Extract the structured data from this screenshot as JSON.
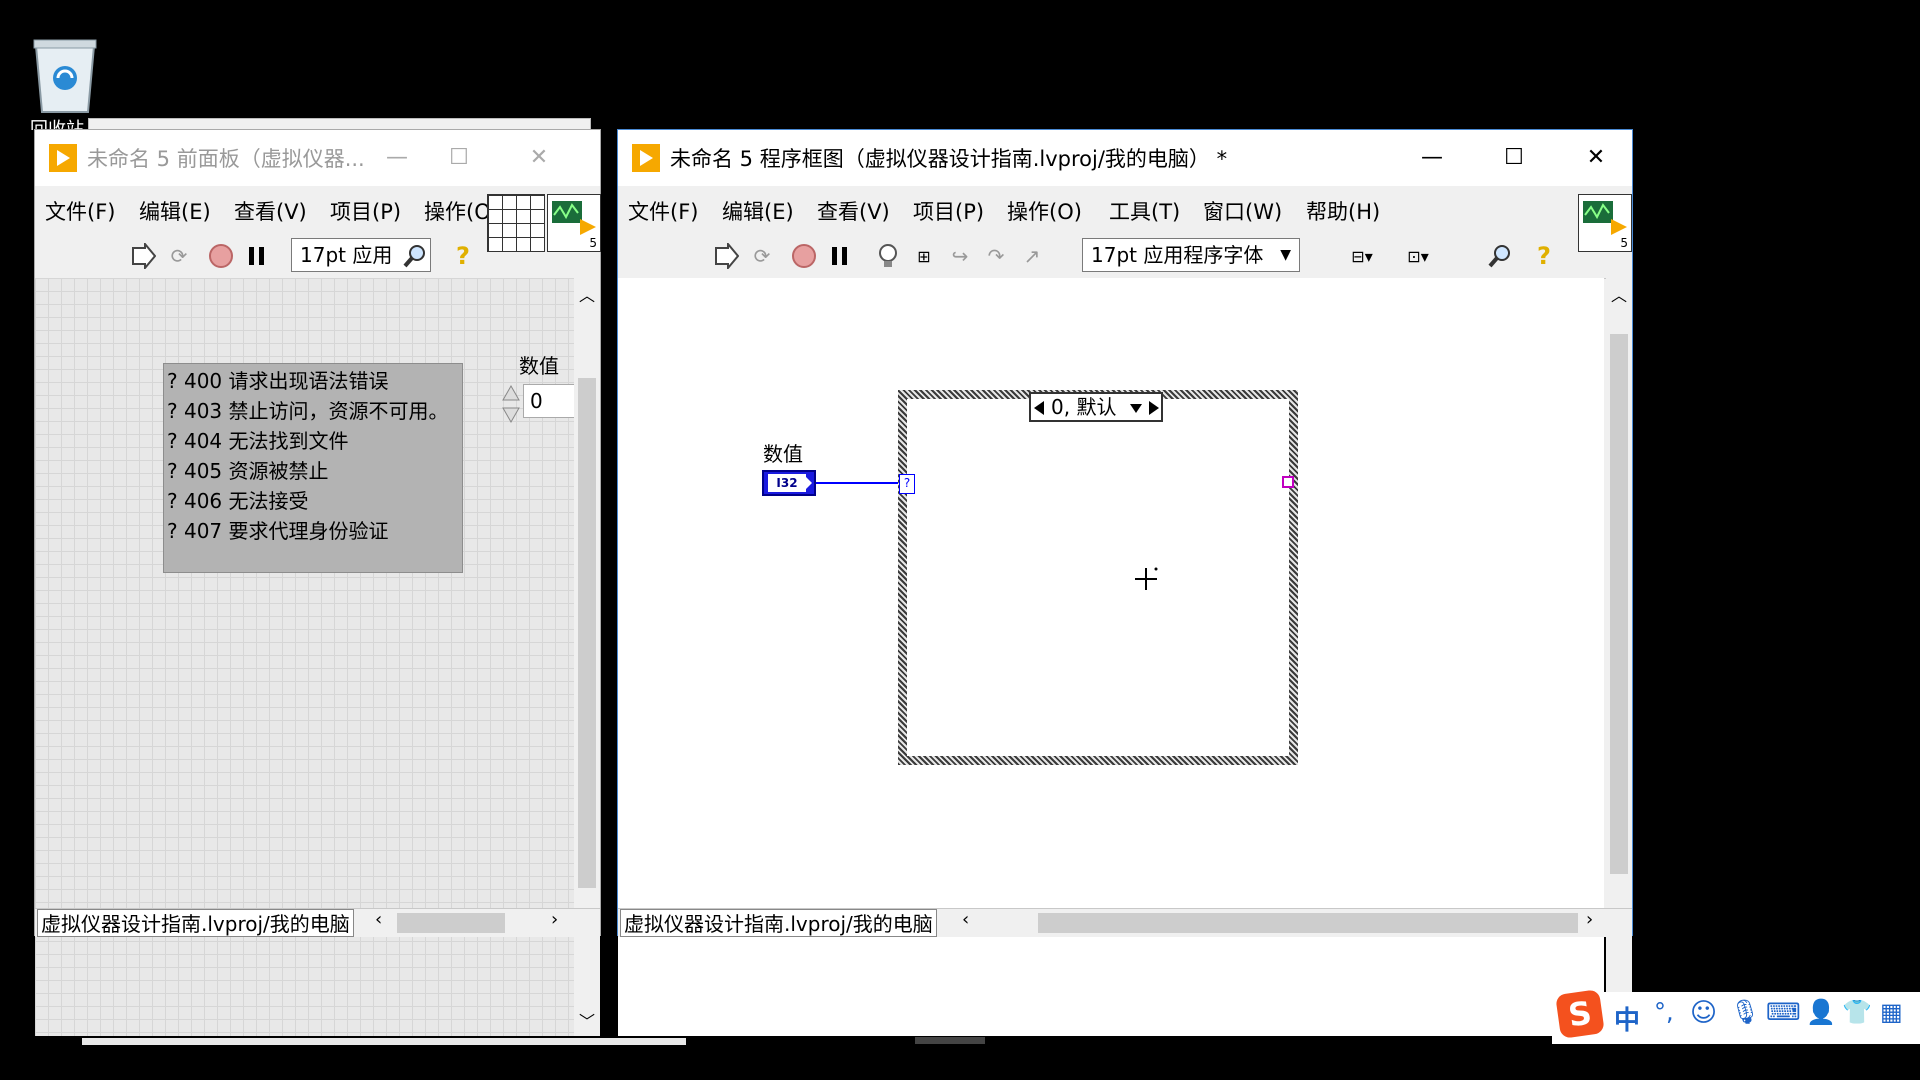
{
  "desktop": {
    "recycle_bin_label": "回收站"
  },
  "front_panel": {
    "title": "未命名 5 前面板（虚拟仪器...",
    "menus": [
      "文件(F)",
      "编辑(E)",
      "查看(V)",
      "项目(P)",
      "操作(O"
    ],
    "font_selector": "17pt 应用",
    "list_items": [
      "? 400 请求出现语法错误",
      "? 403 禁止访问，资源不可用。",
      "? 404 无法找到文件",
      "? 405 资源被禁止",
      "? 406 无法接受",
      "? 407 要求代理身份验证"
    ],
    "numeric_label": "数值",
    "numeric_value": "0",
    "status_path": "虚拟仪器设计指南.lvproj/我的电脑",
    "icon_badge": "5"
  },
  "block_diagram": {
    "title": "未命名 5 程序框图（虚拟仪器设计指南.lvproj/我的电脑） *",
    "menus": [
      "文件(F)",
      "编辑(E)",
      "查看(V)",
      "项目(P)",
      "操作(O)",
      "工具(T)",
      "窗口(W)",
      "帮助(H)"
    ],
    "font_selector": "17pt 应用程序字体",
    "numeric_label": "数值",
    "terminal_type": "I32",
    "case_selector": "0, 默认",
    "selector_terminal": "?",
    "status_path": "虚拟仪器设计指南.lvproj/我的电脑",
    "icon_badge": "5"
  },
  "taskbar_ime": {
    "lang": "中"
  },
  "colors": {
    "labview_orange": "#f6a800",
    "wire_blue": "#0000ff",
    "tunnel_pink": "#c000c0"
  }
}
